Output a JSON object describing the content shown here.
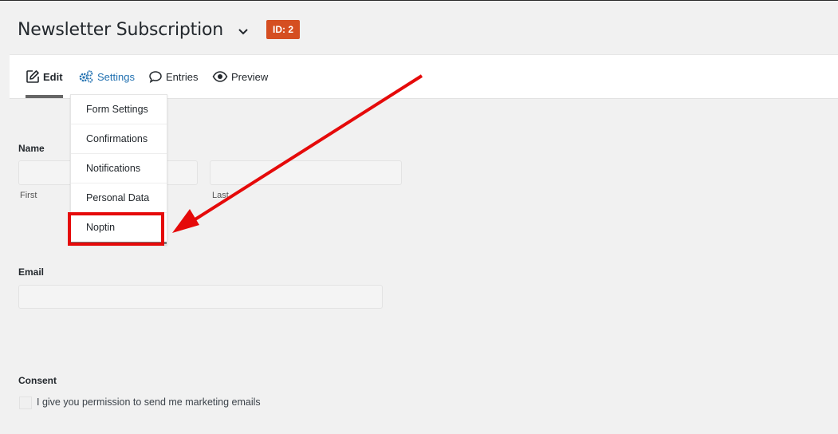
{
  "header": {
    "form_title": "Newsletter Subscription",
    "id_badge": "ID: 2"
  },
  "tabs": {
    "edit": "Edit",
    "settings": "Settings",
    "entries": "Entries",
    "preview": "Preview"
  },
  "settings_menu": {
    "items": [
      "Form Settings",
      "Confirmations",
      "Notifications",
      "Personal Data",
      "Noptin"
    ],
    "highlighted": "Noptin"
  },
  "form": {
    "name_label": "Name",
    "first_label": "First",
    "last_label": "Last",
    "email_label": "Email",
    "consent_label": "Consent",
    "consent_text": "I give you permission to send me marketing emails"
  },
  "annotation": {
    "color": "#e50a0a"
  }
}
